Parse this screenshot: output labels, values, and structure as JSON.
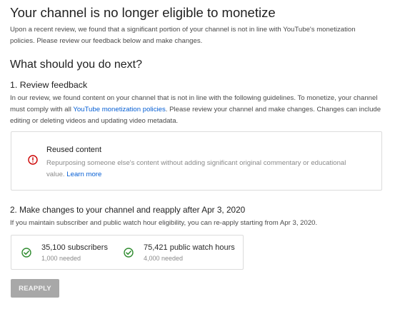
{
  "header": {
    "title": "Your channel is no longer eligible to monetize",
    "intro": "Upon a recent review, we found that a significant portion of your channel is not in line with YouTube's monetization policies. Please review our feedback below and make changes."
  },
  "next": {
    "title": "What should you do next?"
  },
  "step1": {
    "title": "1. Review feedback",
    "text_before_link": "In our review, we found content on your channel that is not in line with the following guidelines. To monetize, your channel must comply with all ",
    "link": "YouTube monetization policies",
    "text_after_link": ". Please review your channel and make changes. Changes can include editing or deleting videos and updating video metadata.",
    "issue": {
      "icon": "error-icon",
      "icon_color": "#cc0000",
      "title": "Reused content",
      "description": "Repurposing someone else's content without adding significant original commentary or educational value.",
      "learn_more": "Learn more"
    }
  },
  "step2": {
    "title": "2. Make changes to your channel and reapply after Apr 3, 2020",
    "text": "If you maintain subscriber and public watch hour eligibility, you can re-apply starting from Apr 3, 2020.",
    "stats": [
      {
        "icon": "check-circle-icon",
        "value": "35,100 subscribers",
        "needed": "1,000 needed"
      },
      {
        "icon": "check-circle-icon",
        "value": "75,421 public watch hours",
        "needed": "4,000 needed"
      }
    ],
    "check_color": "#2e8b2e"
  },
  "actions": {
    "reapply_label": "REAPPLY",
    "reapply_state": "disabled"
  }
}
